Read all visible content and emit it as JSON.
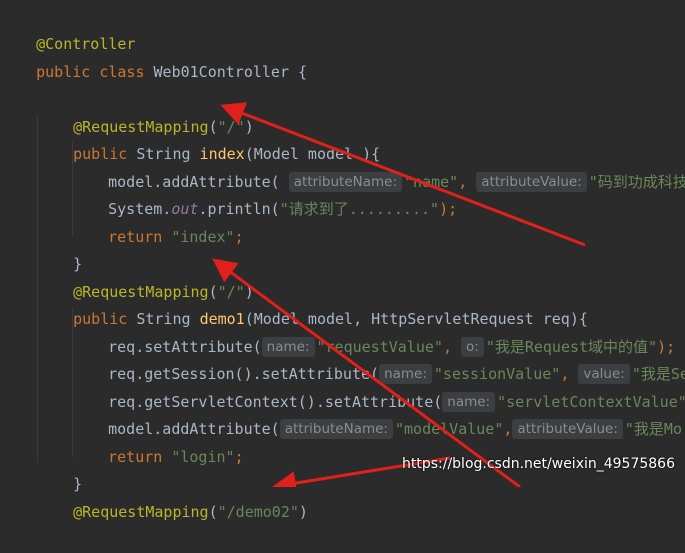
{
  "code": {
    "l1_annotation": "@Controller",
    "l2_kw": "public class",
    "l2_classname": "Web01Controller",
    "l2_brace": "{",
    "l4_annotation": "@RequestMapping",
    "l4_paren_open": "(",
    "l4_path": "\"/\"",
    "l4_paren_close": ")",
    "l5_kw": "public",
    "l5_type": "String",
    "l5_method": "index",
    "l5_params": "(Model model ){",
    "l6_call": "model.addAttribute(",
    "l6_hint1": "attributeName:",
    "l6_str1": "\"name\"",
    "l6_comma": ",",
    "l6_hint2": "attributeValue:",
    "l6_str2": "\"码到功成科技",
    "l7_system": "System.",
    "l7_out": "out",
    "l7_println": ".println(",
    "l7_str": "\"请求到了.........\"",
    "l7_end": ");",
    "l8_kw": "return",
    "l8_str": "\"index\"",
    "l8_end": ";",
    "l9_brace": "}",
    "l10_annotation": "@RequestMapping",
    "l10_paren_open": "(",
    "l10_path": "\"/\"",
    "l10_paren_close": ")",
    "l11_kw": "public",
    "l11_type": "String",
    "l11_method": "demo1",
    "l11_params": "(Model model, HttpServletRequest req){",
    "l12_call": "req.setAttribute(",
    "l12_hint1": "name:",
    "l12_str1": "\"requestValue\"",
    "l12_comma": ",",
    "l12_hint2": "o:",
    "l12_str2": "\"我是Request域中的值\"",
    "l12_end": ");",
    "l13_call": "req.getSession().setAttribute(",
    "l13_hint1": "name:",
    "l13_str1": "\"sessionValue\"",
    "l13_comma": ",",
    "l13_hint2": "value:",
    "l13_str2": "\"我是Ses",
    "l14_call": "req.getServletContext().setAttribute(",
    "l14_hint1": "name:",
    "l14_str1": "\"servletContextValue\"",
    "l14_comma": ",",
    "l15_call": "model.addAttribute(",
    "l15_hint1": "attributeName:",
    "l15_str1": "\"modelValue\"",
    "l15_comma": ",",
    "l15_hint2": "attributeValue:",
    "l15_str2": "\"我是Mo",
    "l16_kw": "return",
    "l16_str": "\"login\"",
    "l16_end": ";",
    "l17_brace": "}",
    "l18_annotation": "@RequestMapping",
    "l18_paren_open": "(",
    "l18_path": "\"/demo02\"",
    "l18_paren_close": ")"
  },
  "watermark": "https://blog.csdn.net/weixin_49575866",
  "colors": {
    "background": "#2b2b2b",
    "annotation": "#bbb529",
    "keyword": "#cc7832",
    "string": "#6a8759",
    "method": "#ffc66d",
    "field": "#9876aa",
    "arrow": "#e0201b"
  },
  "icons": [
    "arrow-annotation"
  ]
}
